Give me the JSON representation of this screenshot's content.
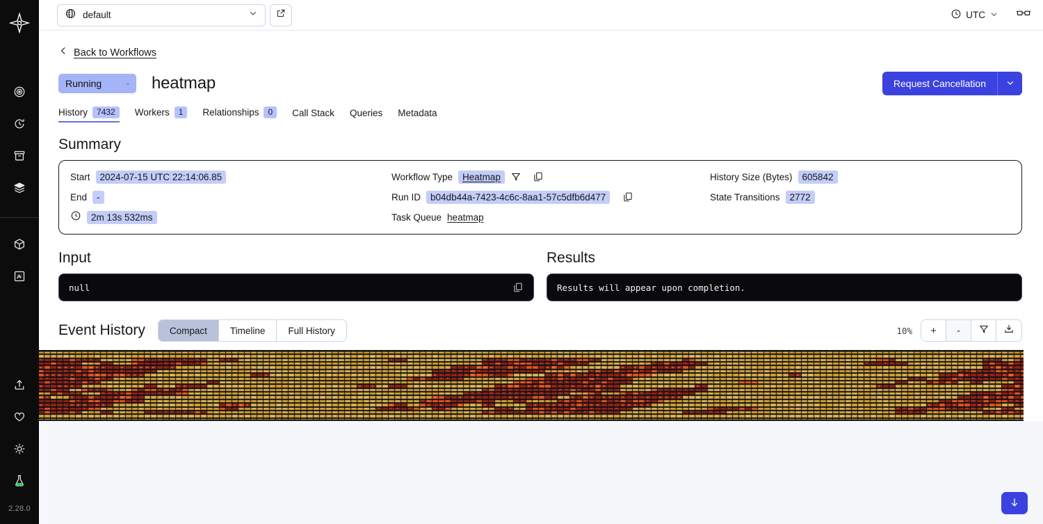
{
  "rail": {
    "logo_icon": "temporal-logo-icon",
    "version": "2.28.0",
    "items": [
      {
        "name": "sidebar-item-workflows",
        "icon": "eye-target-icon"
      },
      {
        "name": "sidebar-item-schedules",
        "icon": "clock-arrow-icon"
      },
      {
        "name": "sidebar-item-archive",
        "icon": "archive-box-icon"
      },
      {
        "name": "sidebar-item-batch-operations",
        "icon": "layers-icon"
      },
      {
        "name": "sidebar-item-namespaces",
        "icon": "cube-icon"
      },
      {
        "name": "sidebar-item-nexus",
        "icon": "book-code-icon"
      }
    ],
    "bottom_items": [
      {
        "name": "sidebar-item-import",
        "icon": "upload-icon"
      },
      {
        "name": "sidebar-item-feedback",
        "icon": "heart-icon"
      },
      {
        "name": "sidebar-item-theme",
        "icon": "sun-icon"
      },
      {
        "name": "sidebar-item-labs",
        "icon": "flask-icon"
      }
    ]
  },
  "topbar": {
    "namespace_icon": "namespace-icon",
    "namespace": "default",
    "namespace_caret_icon": "chevron-down-icon",
    "external_link_icon": "external-link-icon",
    "timezone_icon": "clock-icon",
    "timezone": "UTC",
    "timezone_caret_icon": "chevron-down-icon",
    "reading_mode_icon": "glasses-icon"
  },
  "header": {
    "back_icon": "chevron-left-icon",
    "back_label": "Back to Workflows",
    "status": "Running",
    "status_dash": "-",
    "workflow_name": "heatmap",
    "cancel_button": "Request Cancellation",
    "cancel_caret_icon": "chevron-down-icon"
  },
  "tabs": [
    {
      "label": "History",
      "badge": "7432",
      "active": true
    },
    {
      "label": "Workers",
      "badge": "1",
      "active": false
    },
    {
      "label": "Relationships",
      "badge": "0",
      "active": false
    },
    {
      "label": "Call Stack",
      "badge": "",
      "active": false
    },
    {
      "label": "Queries",
      "badge": "",
      "active": false
    },
    {
      "label": "Metadata",
      "badge": "",
      "active": false
    }
  ],
  "summary": {
    "title": "Summary",
    "start_label": "Start",
    "start_value": "2024-07-15 UTC 22:14:06.85",
    "end_label": "End",
    "end_value": "-",
    "duration_icon": "clock-icon",
    "duration_value": "2m 13s 532ms",
    "workflow_type_label": "Workflow Type",
    "workflow_type_value": "Heatmap",
    "workflow_type_filter_icon": "filter-funnel-icon",
    "workflow_type_copy_icon": "copy-icon",
    "run_id_label": "Run ID",
    "run_id_value": "b04db44a-7423-4c6c-8aa1-57c5dfb6d477",
    "run_id_copy_icon": "copy-icon",
    "task_queue_label": "Task Queue",
    "task_queue_value": "heatmap",
    "history_size_label": "History Size (Bytes)",
    "history_size_value": "605842",
    "state_transitions_label": "State Transitions",
    "state_transitions_value": "2772"
  },
  "input": {
    "title": "Input",
    "value": "null",
    "copy_icon": "copy-icon"
  },
  "results": {
    "title": "Results",
    "value": "Results will appear upon completion."
  },
  "event_history": {
    "title": "Event History",
    "views": [
      {
        "label": "Compact",
        "active": true
      },
      {
        "label": "Timeline",
        "active": false
      },
      {
        "label": "Full History",
        "active": false
      }
    ],
    "zoom_level": "10%",
    "zoom_in_label": "+",
    "zoom_out_label": "-",
    "filter_icon": "filter-funnel-icon",
    "download_icon": "download-icon",
    "scroll_bottom_icon": "arrow-down-icon"
  },
  "colors": {
    "accent": "#3b42e0",
    "badge": "#b7c2fb",
    "chip": "#c3cdf7",
    "status_pill": "#a5b4f7",
    "heat_gold": "#d6a233",
    "heat_gold_light": "#e0b753",
    "heat_dark_red": "#8e2418",
    "heat_orange": "#e8551f",
    "heat_bg": "#111114"
  },
  "heatmap": {
    "type": "heatmap",
    "description": "Compact event history bands",
    "rows": 19,
    "cols": 160,
    "palette": [
      "#d6a233",
      "#e0b753",
      "#8e2418",
      "#e8551f",
      "#b9b0a6"
    ],
    "seed": 20240715
  }
}
